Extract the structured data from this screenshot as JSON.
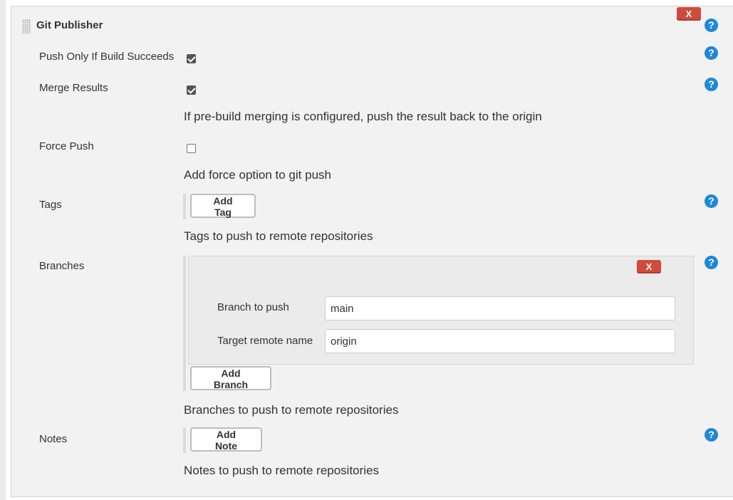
{
  "section": {
    "title": "Git Publisher",
    "delete_label": "X",
    "help_label": "?"
  },
  "options": {
    "push_only_if_success": {
      "label": "Push Only If Build Succeeds",
      "checked": true
    },
    "merge_results": {
      "label": "Merge Results",
      "checked": true,
      "description": "If pre-build merging is configured, push the result back to the origin"
    },
    "force_push": {
      "label": "Force Push",
      "checked": false,
      "description": "Add force option to git push"
    }
  },
  "tags": {
    "label": "Tags",
    "add_button": "Add Tag",
    "description": "Tags to push to remote repositories"
  },
  "branches": {
    "label": "Branches",
    "delete_label": "X",
    "branch_to_push_label": "Branch to push",
    "branch_to_push_value": "main",
    "target_remote_label": "Target remote name",
    "target_remote_value": "origin",
    "add_button": "Add Branch",
    "description": "Branches to push to remote repositories"
  },
  "notes": {
    "label": "Notes",
    "add_button": "Add Note",
    "description": "Notes to push to remote repositories"
  },
  "colors": {
    "help": "#1e88d6",
    "delete": "#d24a3b",
    "panel": "#f2f2f2"
  }
}
